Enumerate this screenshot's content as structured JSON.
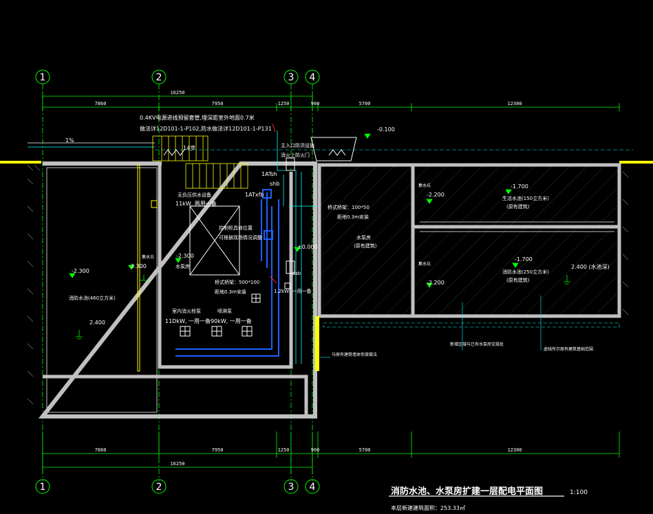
{
  "grid_axes": [
    "1",
    "2",
    "3",
    "4"
  ],
  "dims_top": {
    "total": "16250",
    "segments": [
      "7860",
      "7950",
      "1250",
      "900",
      "5700",
      "12300"
    ]
  },
  "dims_bottom": {
    "total": "16250",
    "segments": [
      "7860",
      "7950",
      "1250",
      "900",
      "5700",
      "12300"
    ]
  },
  "notes": {
    "cable_note_1": "0.4KV电源进线预留套管,埋深距室外地面0.7米",
    "cable_note_2": "做法详12D101-1-P102,防水做法详12D101-1-P131",
    "slope": "1%",
    "steps": "14步",
    "elev_top": "-0.100",
    "entrance_note_1": "主入口防洪设施",
    "entrance_note_2": "消火上防火门",
    "panel_atsh": "1ATsh",
    "panel_shb": "shb",
    "panel_atxfb": "1ATxfb",
    "equip_1": "无负压供水设备",
    "equip_1_power": "11kW, 两用一备",
    "control_cabinet_1": "控制柜具体位置",
    "control_cabinet_2": "可根据现场情况调整",
    "tray_1_1": "桥式桥架：500*100",
    "tray_1_2": "距地0.3m安装",
    "tray_2_1": "桥式桥架：100*50",
    "tray_2_2": "距地0.3m安装",
    "sump": "集水坑",
    "fire_pool_label": "消防水池(460立方米)",
    "elev_fire_pool": "-2.300",
    "elev_pump": "-3.300",
    "elev_pump_room": "-2.300",
    "pump_room": "水泵房",
    "elev_pool_depth": "2.400",
    "hydrant_pump": "室内消火栓泵",
    "hydrant_pump_power": "11DkW, 一用一备",
    "sprinkler_pump": "喷淋泵",
    "sprinkler_pump_power": "90kW, 一用一备",
    "elev_zero": "±0.000",
    "panel_dab": "dab",
    "panel_power": "1.2kW, 一用一备",
    "existing_pump_room": "水泵房",
    "existing_note": "(原有建筑)",
    "elev_sump_1": "-2.200",
    "elev_sump_2": "-2.200",
    "sump_1": "集水坑",
    "sump_2": "集水坑",
    "elev_domestic": "-1.700",
    "domestic_pool": "生活水池(150立方米)",
    "domestic_note": "(原有建筑)",
    "elev_fire_pool_2": "-1.700",
    "fire_pool_2": "消防水池(250立方米)",
    "fire_pool_2_note": "(原有建筑)",
    "elev_pool_2_depth": "2.400 (水池深)",
    "leader_1": "新增区域与已有水泵房交接处",
    "leader_2": "虚线所示原有建筑基础范围",
    "leader_3": "与原有建筑墙体衔接做法"
  },
  "title": {
    "main": "消防水池、水泵房扩建一层配电平面图",
    "scale": "1:100",
    "area": "本层新建建筑面积：253.33㎡"
  },
  "colors": {
    "bg": "#000000",
    "grid": "#00ff00",
    "wall": "#c0c0c0",
    "yellow": "#ffff00",
    "cyan": "#00ffff",
    "blue": "#2060ff",
    "white": "#ffffff",
    "red": "#ff2020"
  }
}
